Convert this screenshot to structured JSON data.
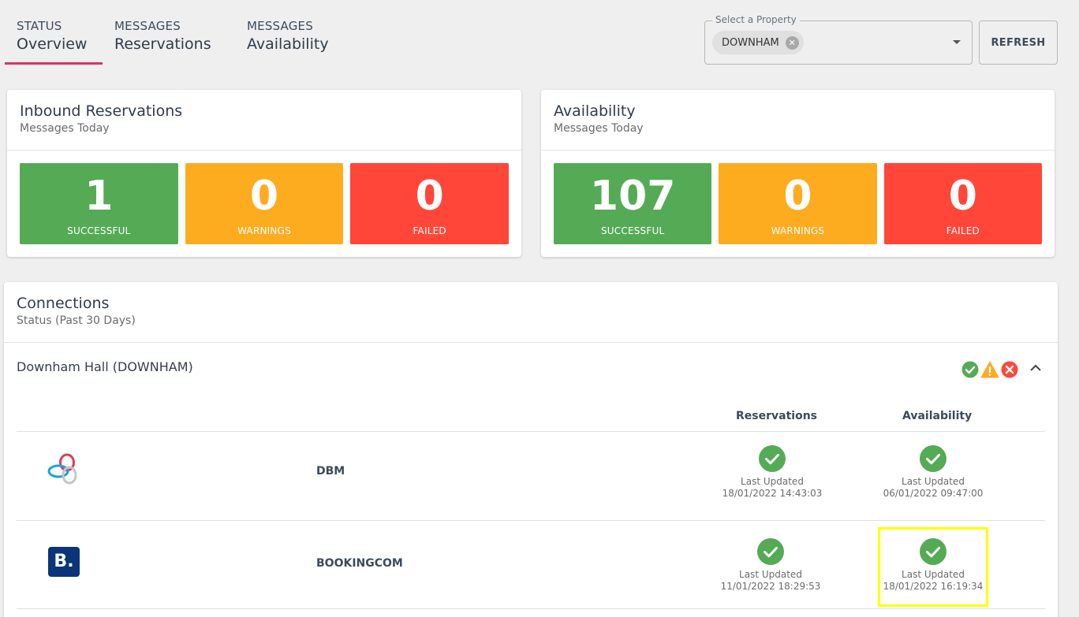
{
  "tabs": [
    {
      "small": "STATUS",
      "big": "Overview",
      "active": true
    },
    {
      "small": "MESSAGES",
      "big": "Reservations",
      "active": false
    },
    {
      "small": "MESSAGES",
      "big": "Availability",
      "active": false
    }
  ],
  "property_select": {
    "legend": "Select a Property",
    "chip": "DOWNHAM"
  },
  "refresh_label": "REFRESH",
  "inbound": {
    "title": "Inbound Reservations",
    "subtitle": "Messages Today",
    "tiles": [
      {
        "value": "1",
        "label": "SUCCESSFUL",
        "color": "#55aa56"
      },
      {
        "value": "0",
        "label": "WARNINGS",
        "color": "#fdab1f"
      },
      {
        "value": "0",
        "label": "FAILED",
        "color": "#ff4639"
      }
    ]
  },
  "availability": {
    "title": "Availability",
    "subtitle": "Messages Today",
    "tiles": [
      {
        "value": "107",
        "label": "SUCCESSFUL",
        "color": "#55aa56"
      },
      {
        "value": "0",
        "label": "WARNINGS",
        "color": "#fdab1f"
      },
      {
        "value": "0",
        "label": "FAILED",
        "color": "#ff4639"
      }
    ]
  },
  "connections": {
    "title": "Connections",
    "subtitle": "Status (Past 30 Days)",
    "group": "Downham Hall (DOWNHAM)",
    "col_reservations": "Reservations",
    "col_availability": "Availability",
    "rows": [
      {
        "name": "DBM",
        "logo": "dbm-logo",
        "reservations": {
          "label": "Last Updated",
          "time": "18/01/2022 14:43:03"
        },
        "availability": {
          "label": "Last Updated",
          "time": "06/01/2022 09:47:00"
        }
      },
      {
        "name": "BOOKINGCOM",
        "logo": "booking-logo",
        "logo_text": "B.",
        "reservations": {
          "label": "Last Updated",
          "time": "11/01/2022 18:29:53"
        },
        "availability": {
          "label": "Last Updated",
          "time": "18/01/2022 16:19:34"
        }
      }
    ]
  }
}
